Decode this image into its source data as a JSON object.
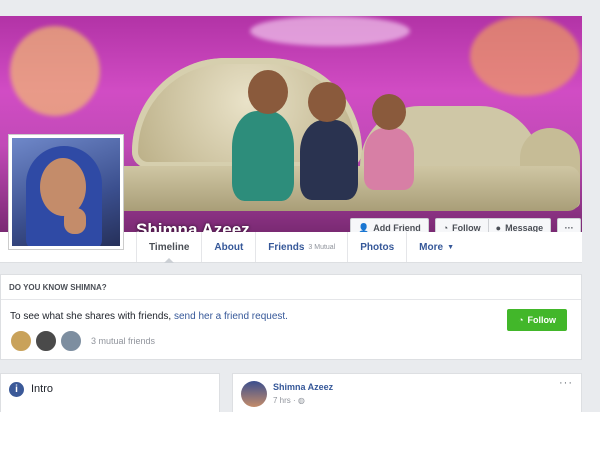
{
  "profile": {
    "name": "Shimna Azeez"
  },
  "cover_actions": {
    "add_friend": "Add Friend",
    "follow": "Follow",
    "message": "Message",
    "more": "···"
  },
  "tabs": [
    {
      "label": "Timeline",
      "active": true
    },
    {
      "label": "About"
    },
    {
      "label": "Friends",
      "sub": "3 Mutual"
    },
    {
      "label": "Photos"
    },
    {
      "label": "More",
      "caret": "▼"
    }
  ],
  "know": {
    "title": "DO YOU KNOW SHIMNA?",
    "text": "To see what she shares with friends,",
    "link": "send her a friend request.",
    "follow": "Follow",
    "mutual": "3 mutual friends"
  },
  "intro": {
    "icon": "i",
    "title": "Intro"
  },
  "post": {
    "author": "Shimna Azeez",
    "time": "7 hrs ·",
    "menu": "···"
  },
  "colors": {
    "link_blue": "#365899",
    "follow_green": "#42b72a",
    "cover_magenta": "#c14ab7"
  }
}
